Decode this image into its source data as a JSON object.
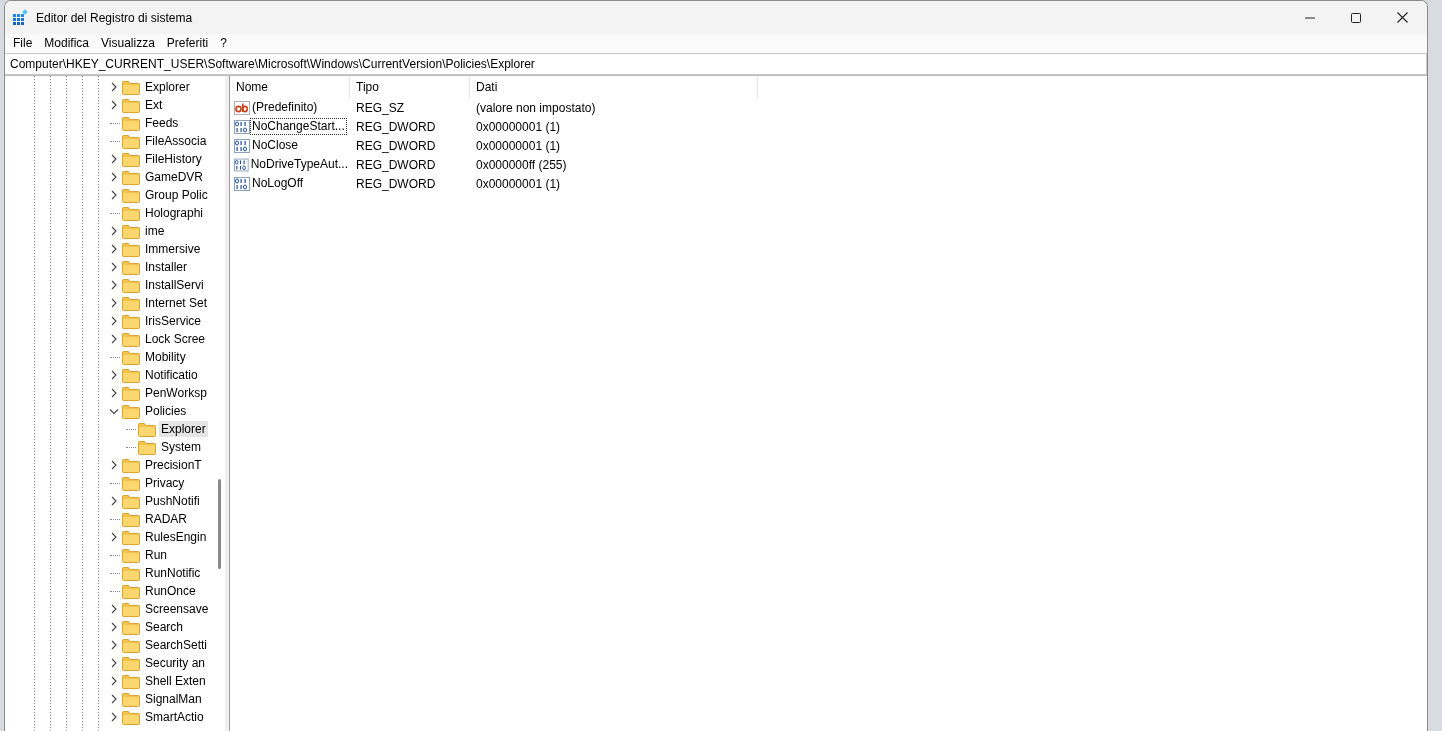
{
  "window": {
    "title": "Editor del Registro di sistema"
  },
  "menu": [
    "File",
    "Modifica",
    "Visualizza",
    "Preferiti",
    "?"
  ],
  "address": "Computer\\HKEY_CURRENT_USER\\Software\\Microsoft\\Windows\\CurrentVersion\\Policies\\Explorer",
  "tree": [
    {
      "label": "Explorer",
      "expandable": true,
      "selected": false
    },
    {
      "label": "Ext",
      "expandable": true,
      "selected": false
    },
    {
      "label": "Feeds",
      "expandable": false,
      "selected": false
    },
    {
      "label": "FileAssocia",
      "expandable": false,
      "selected": false
    },
    {
      "label": "FileHistory",
      "expandable": true,
      "selected": false
    },
    {
      "label": "GameDVR",
      "expandable": true,
      "selected": false
    },
    {
      "label": "Group Polic",
      "expandable": true,
      "selected": false
    },
    {
      "label": "Holographi",
      "expandable": false,
      "selected": false
    },
    {
      "label": "ime",
      "expandable": true,
      "selected": false
    },
    {
      "label": "Immersive",
      "expandable": true,
      "selected": false
    },
    {
      "label": "Installer",
      "expandable": true,
      "selected": false
    },
    {
      "label": "InstallServi",
      "expandable": true,
      "selected": false
    },
    {
      "label": "Internet Set",
      "expandable": true,
      "selected": false
    },
    {
      "label": "IrisService",
      "expandable": true,
      "selected": false
    },
    {
      "label": "Lock Scree",
      "expandable": true,
      "selected": false
    },
    {
      "label": "Mobility",
      "expandable": false,
      "selected": false
    },
    {
      "label": "Notificatio",
      "expandable": true,
      "selected": false
    },
    {
      "label": "PenWorksp",
      "expandable": true,
      "selected": false
    },
    {
      "label": "Policies",
      "expandable": true,
      "selected": false,
      "children": [
        {
          "label": "Explorer",
          "expandable": false,
          "selected": true
        },
        {
          "label": "System",
          "expandable": false,
          "selected": false
        }
      ]
    },
    {
      "label": "PrecisionT",
      "expandable": true,
      "selected": false
    },
    {
      "label": "Privacy",
      "expandable": false,
      "selected": false
    },
    {
      "label": "PushNotifi",
      "expandable": true,
      "selected": false
    },
    {
      "label": "RADAR",
      "expandable": false,
      "selected": false
    },
    {
      "label": "RulesEngin",
      "expandable": true,
      "selected": false
    },
    {
      "label": "Run",
      "expandable": false,
      "selected": false
    },
    {
      "label": "RunNotific",
      "expandable": false,
      "selected": false
    },
    {
      "label": "RunOnce",
      "expandable": false,
      "selected": false
    },
    {
      "label": "Screensave",
      "expandable": true,
      "selected": false
    },
    {
      "label": "Search",
      "expandable": true,
      "selected": false
    },
    {
      "label": "SearchSetti",
      "expandable": true,
      "selected": false
    },
    {
      "label": "Security an",
      "expandable": true,
      "selected": false
    },
    {
      "label": "Shell Exten",
      "expandable": true,
      "selected": false
    },
    {
      "label": "SignalMan",
      "expandable": true,
      "selected": false
    },
    {
      "label": "SmartActio",
      "expandable": true,
      "selected": false
    }
  ],
  "values": {
    "columns": [
      "Nome",
      "Tipo",
      "Dati"
    ],
    "rows": [
      {
        "kind": "string",
        "name": "(Predefinito)",
        "type": "REG_SZ",
        "data": "(valore non impostato)",
        "focused": false
      },
      {
        "kind": "binary",
        "name": "NoChangeStart...",
        "type": "REG_DWORD",
        "data": "0x00000001 (1)",
        "focused": true
      },
      {
        "kind": "binary",
        "name": "NoClose",
        "type": "REG_DWORD",
        "data": "0x00000001 (1)",
        "focused": false
      },
      {
        "kind": "binary",
        "name": "NoDriveTypeAut...",
        "type": "REG_DWORD",
        "data": "0x000000ff (255)",
        "focused": false
      },
      {
        "kind": "binary",
        "name": "NoLogOff",
        "type": "REG_DWORD",
        "data": "0x00000001 (1)",
        "focused": false
      }
    ]
  }
}
